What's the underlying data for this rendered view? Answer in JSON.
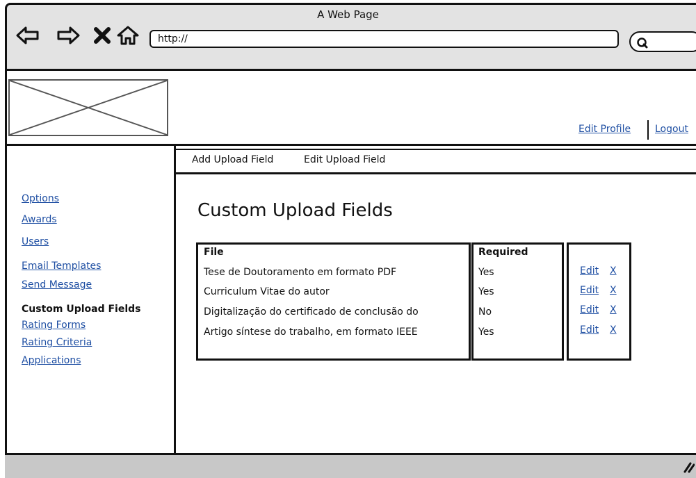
{
  "window": {
    "title": "A Web Page"
  },
  "toolbar": {
    "url": "http://"
  },
  "header": {
    "edit_profile": "Edit Profile",
    "logout": "Logout"
  },
  "sidebar": {
    "items": [
      {
        "label": "Options",
        "current": false
      },
      {
        "label": "Awards",
        "current": false
      },
      {
        "label": "Users",
        "current": false
      },
      {
        "label": "Email Templates",
        "current": false
      },
      {
        "label": "Send Message",
        "current": false
      },
      {
        "label": "Custom Upload Fields",
        "current": true
      },
      {
        "label": "Rating Forms",
        "current": false
      },
      {
        "label": "Rating Criteria",
        "current": false
      },
      {
        "label": "Applications",
        "current": false
      }
    ]
  },
  "tabs": [
    "Add Upload Field",
    "Edit Upload Field"
  ],
  "main": {
    "title": "Custom Upload Fields",
    "table": {
      "headers": {
        "file": "File",
        "required": "Required"
      },
      "rows": [
        {
          "file": "Tese de Doutoramento em formato PDF",
          "required": "Yes",
          "edit": "Edit",
          "delete": "X"
        },
        {
          "file": "Curriculum Vitae do autor",
          "required": "Yes",
          "edit": "Edit",
          "delete": "X"
        },
        {
          "file": "Digitalização do certificado de conclusão do",
          "required": "No",
          "edit": "Edit",
          "delete": "X"
        },
        {
          "file": "Artigo síntese do trabalho, em formato IEEE",
          "required": "Yes",
          "edit": "Edit",
          "delete": "X"
        }
      ]
    }
  },
  "colors": {
    "link": "#1f4fa3",
    "chrome": "#e3e3e3",
    "footer": "#c8c8c8"
  }
}
